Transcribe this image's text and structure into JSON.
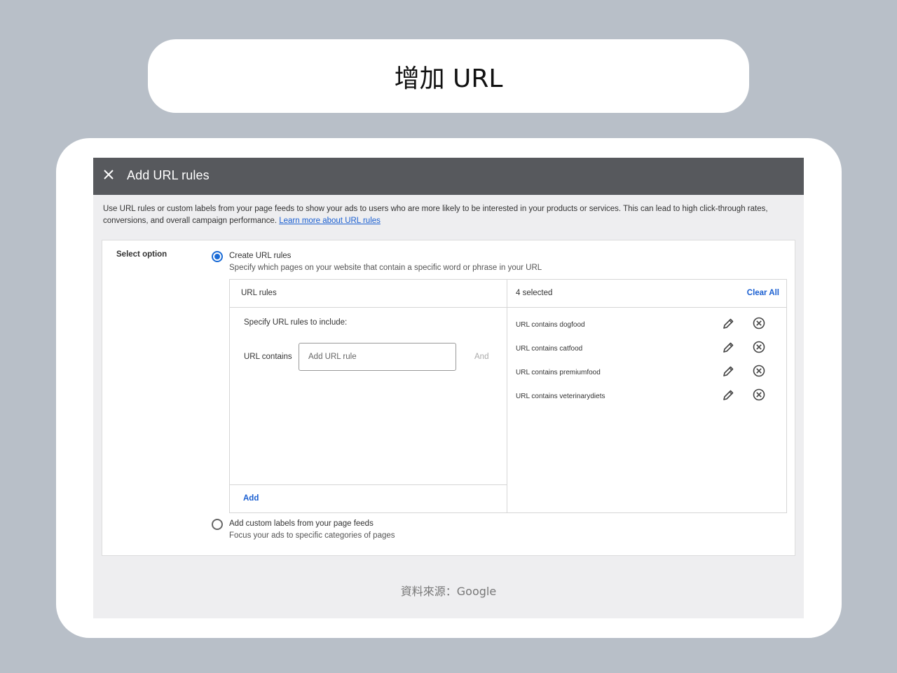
{
  "slide": {
    "title": "增加 URL",
    "source": "資料來源：Google"
  },
  "dialog": {
    "title": "Add URL rules",
    "intro_text": "Use URL rules or custom labels from your page feeds to show your ads to users who are more likely to be interested in your products or services. This can lead to high click-through rates, conversions, and overall campaign performance. ",
    "learn_more": "Learn more about URL rules",
    "select_option_label": "Select option",
    "option_create": {
      "title": "Create URL rules",
      "subtitle": "Specify which pages on your website that contain a specific word or phrase in your URL",
      "selected": true
    },
    "option_labels": {
      "title": "Add custom labels from your page feeds",
      "subtitle": "Focus your ads to specific categories of pages",
      "selected": false
    },
    "rules_panel": {
      "left_header": "URL rules",
      "specify_label": "Specify URL rules to include:",
      "url_contains_label": "URL contains",
      "input_placeholder": "Add URL rule",
      "input_value": "",
      "and_label": "And",
      "add_label": "Add",
      "right_header": "4 selected",
      "clear_all": "Clear All",
      "rules": [
        "URL contains dogfood",
        "URL contains catfood",
        "URL contains premiumfood",
        "URL contains veterinarydiets"
      ]
    }
  },
  "colors": {
    "header_bg": "#57595d",
    "link_blue": "#1a5fd1",
    "radio_blue": "#1a6bd6",
    "slide_bg": "#b8bfc8"
  },
  "icons": {
    "close": "close-icon",
    "edit": "pencil-icon",
    "remove": "remove-circle-icon"
  }
}
